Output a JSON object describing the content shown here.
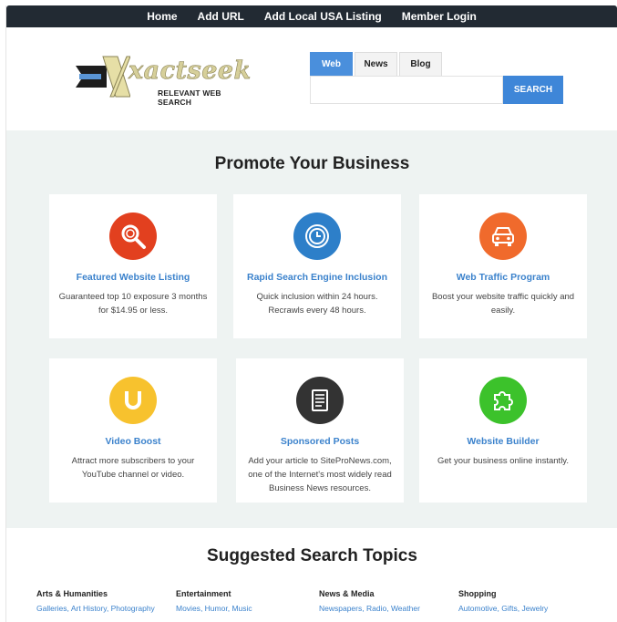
{
  "nav": [
    "Home",
    "Add URL",
    "Add Local USA Listing",
    "Member Login"
  ],
  "logo": {
    "word": "xactseek",
    "tagline": "RELEVANT WEB SEARCH"
  },
  "search": {
    "tabs": [
      "Web",
      "News",
      "Blog"
    ],
    "active_tab": "Web",
    "value": "",
    "button": "SEARCH"
  },
  "promote": {
    "heading": "Promote Your Business",
    "cards": [
      {
        "icon": "magnifier-icon",
        "color": "#e2401f",
        "title": "Featured Website Listing",
        "desc": "Guaranteed top 10 exposure 3 months for $14.95 or less."
      },
      {
        "icon": "clock-icon",
        "color": "#2d7fc9",
        "title": "Rapid Search Engine Inclusion",
        "desc": "Quick inclusion within 24 hours. Recrawls every 48 hours."
      },
      {
        "icon": "car-icon",
        "color": "#f06a2c",
        "title": "Web Traffic Program",
        "desc": "Boost your website traffic quickly and easily."
      },
      {
        "icon": "magnet-icon",
        "color": "#f7c22e",
        "title": "Video Boost",
        "desc": "Attract more subscribers to your YouTube channel or video."
      },
      {
        "icon": "document-icon",
        "color": "#333333",
        "title": "Sponsored Posts",
        "desc": "Add your article to SiteProNews.com, one of the Internet's most widely read Business News resources."
      },
      {
        "icon": "puzzle-icon",
        "color": "#3cc22b",
        "title": "Website Builder",
        "desc": "Get your business online instantly."
      }
    ]
  },
  "topics": {
    "heading": "Suggested Search Topics",
    "columns": [
      {
        "title": "Arts & Humanities",
        "links": [
          "Galleries",
          "Art History",
          "Photography"
        ]
      },
      {
        "title": "Entertainment",
        "links": [
          "Movies",
          "Humor",
          "Music"
        ]
      },
      {
        "title": "News & Media",
        "links": [
          "Newspapers",
          "Radio",
          "Weather"
        ]
      },
      {
        "title": "Shopping",
        "links": [
          "Automotive",
          "Gifts",
          "Jewelry"
        ]
      }
    ]
  }
}
